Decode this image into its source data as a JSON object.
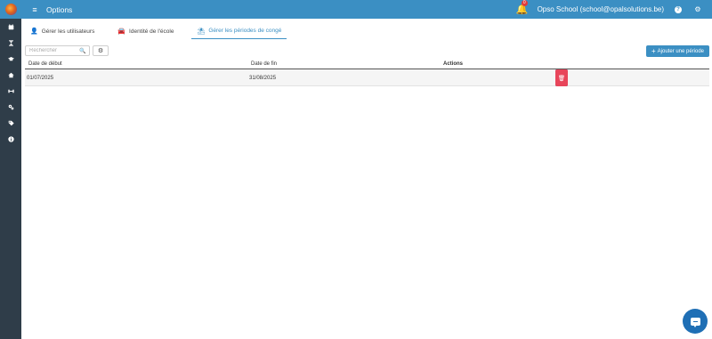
{
  "header": {
    "title": "Options",
    "notification_count": "0",
    "school_label": "Opso School (school@opalsolutions.be)"
  },
  "tabs": [
    {
      "label": "Gérer les utilisateurs",
      "icon": "user-icon"
    },
    {
      "label": "Identité de l'école",
      "icon": "car-icon"
    },
    {
      "label": "Gérer les périodes de congé",
      "icon": "beach-icon",
      "active": true
    }
  ],
  "toolbar": {
    "search_placeholder": "Rechercher",
    "add_label": "Ajouter une période"
  },
  "table": {
    "columns": [
      "Date de début",
      "Date de fin",
      "Actions"
    ],
    "rows": [
      {
        "start": "01/07/2025",
        "end": "31/08/2025"
      }
    ]
  },
  "sidebar": {
    "items": [
      "calendar-icon",
      "hourglass-icon",
      "graduation-cap-icon",
      "home-icon",
      "dumbbell-icon",
      "cogs-icon",
      "tag-icon",
      "info-icon"
    ]
  },
  "colors": {
    "brand": "#3b8fc3",
    "sidebar": "#2f3d49",
    "danger": "#e8455a"
  }
}
